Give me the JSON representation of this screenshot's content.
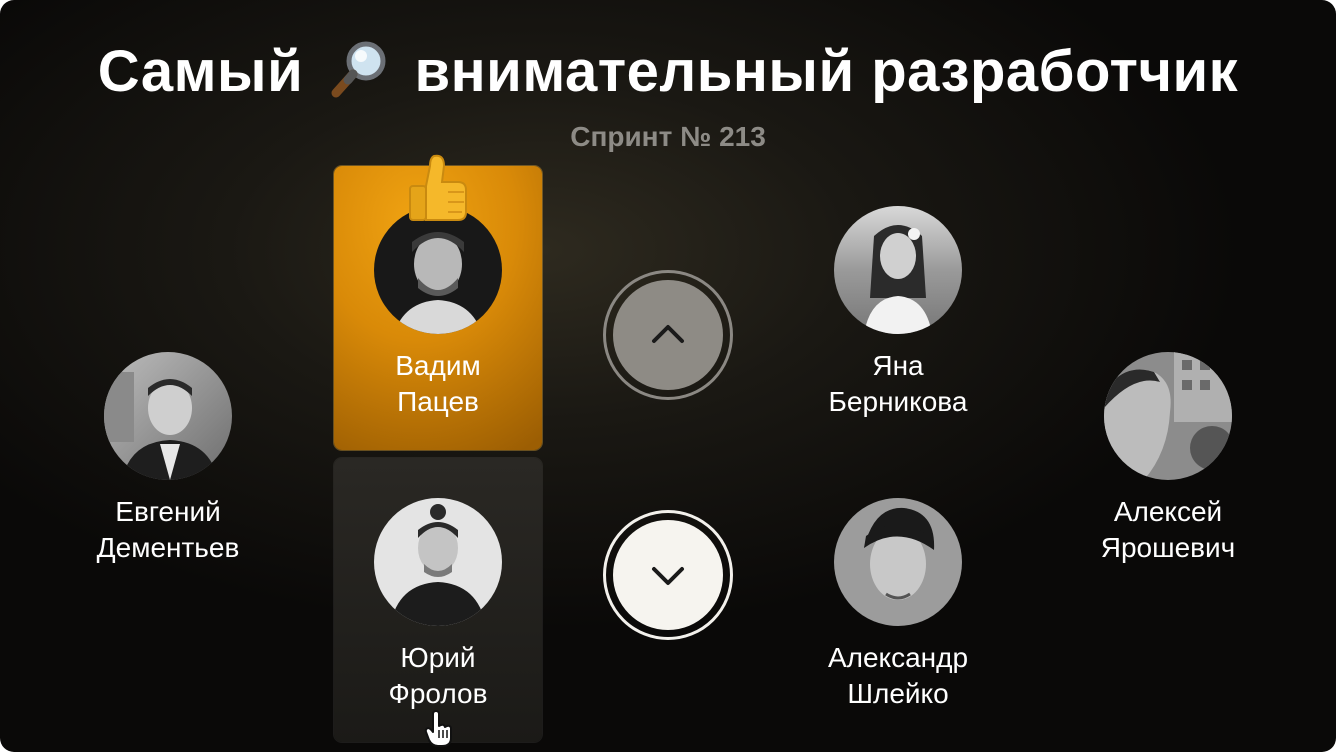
{
  "header": {
    "title_part1": "Самый",
    "title_icon": "magnifying-glass-icon",
    "title_part2": "внимательный разработчик",
    "subtitle": "Спринт № 213"
  },
  "candidates": [
    {
      "first": "Евгений",
      "last": "Дементьев"
    },
    {
      "first": "Вадим",
      "last": "Пацев",
      "selected": true,
      "badge": "thumbs-up-icon"
    },
    {
      "first": "Юрий",
      "last": "Фролов",
      "hovered": true
    },
    {
      "first": "Яна",
      "last": "Берникова"
    },
    {
      "first": "Александр",
      "last": "Шлейко"
    },
    {
      "first": "Алексей",
      "last": "Ярошевич"
    }
  ],
  "controls": {
    "up_icon": "chevron-up-icon",
    "down_icon": "chevron-down-icon"
  },
  "colors": {
    "selected_card": "#d98a08",
    "background": "#14120e",
    "subtitle": "#8d8b86"
  }
}
